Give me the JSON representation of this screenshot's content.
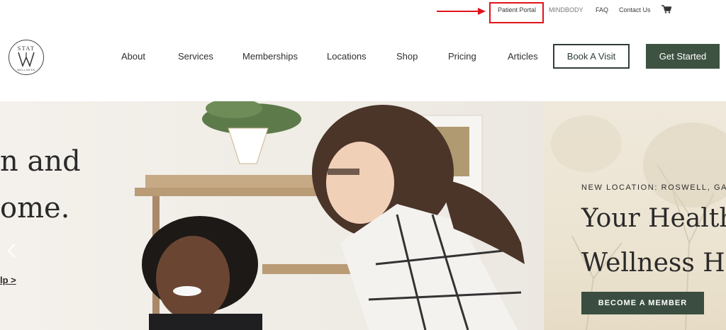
{
  "utility_bar": {
    "links": [
      {
        "id": "patient-portal",
        "label": "Patient Portal"
      },
      {
        "id": "mindbody",
        "label": "MINDBODY"
      },
      {
        "id": "faq",
        "label": "FAQ"
      },
      {
        "id": "contact",
        "label": "Contact Us"
      }
    ],
    "cart_icon": "cart-icon",
    "highlight_color": "#e0141c"
  },
  "logo": {
    "top": "STAT",
    "bottom": "WELLNESS"
  },
  "nav": {
    "items": [
      {
        "label": "About"
      },
      {
        "label": "Services"
      },
      {
        "label": "Memberships"
      },
      {
        "label": "Locations"
      },
      {
        "label": "Shop"
      },
      {
        "label": "Pricing"
      },
      {
        "label": "Articles"
      }
    ],
    "book_label": "Book A Visit",
    "cta_label": "Get Started",
    "accent": "#3e5242"
  },
  "hero": {
    "slide_left": {
      "line1": "n and",
      "line2": "ome.",
      "link": "lp >"
    },
    "prev_icon": "chevron-left-icon",
    "slide_right": {
      "eyebrow": "NEW LOCATION: ROSWELL, GA",
      "title_line1": "Your Health",
      "title_line2": "Wellness H",
      "button": "BECOME A MEMBER"
    }
  }
}
